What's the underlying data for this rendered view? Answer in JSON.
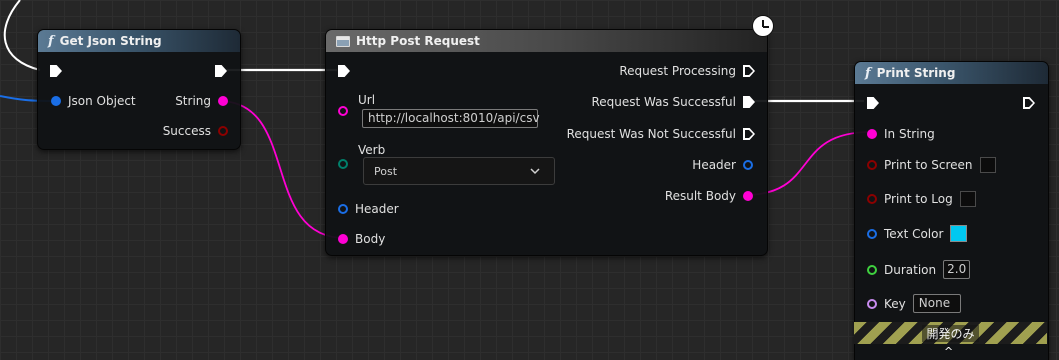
{
  "get_json": {
    "title": "Get Json String",
    "input_label": "Json Object",
    "output_string": "String",
    "output_success": "Success"
  },
  "http": {
    "title": "Http Post Request",
    "url_label": "Url",
    "url_value": "http://localhost:8010/api/csv",
    "verb_label": "Verb",
    "verb_value": "Post",
    "header_in_label": "Header",
    "body_label": "Body",
    "out_processing": "Request Processing",
    "out_successful": "Request Was Successful",
    "out_not_successful": "Request Was Not Successful",
    "out_header": "Header",
    "out_result_body": "Result Body"
  },
  "print": {
    "title": "Print String",
    "in_string": "In String",
    "print_to_screen": "Print to Screen",
    "print_to_log": "Print to Log",
    "text_color": "Text Color",
    "duration_label": "Duration",
    "duration_value": "2.0",
    "key_label": "Key",
    "key_value": "None",
    "dev_only": "開発のみ"
  },
  "colors": {
    "exec": "#ffffff",
    "string_pin": "#ff00d4",
    "struct_pin": "#1a6ee6",
    "bool_pin": "#8c0000",
    "byte_pin": "#00806b",
    "float_pin": "#3fd13f",
    "name_pin": "#c98cf0",
    "text_color_value": "#00c8f0"
  }
}
